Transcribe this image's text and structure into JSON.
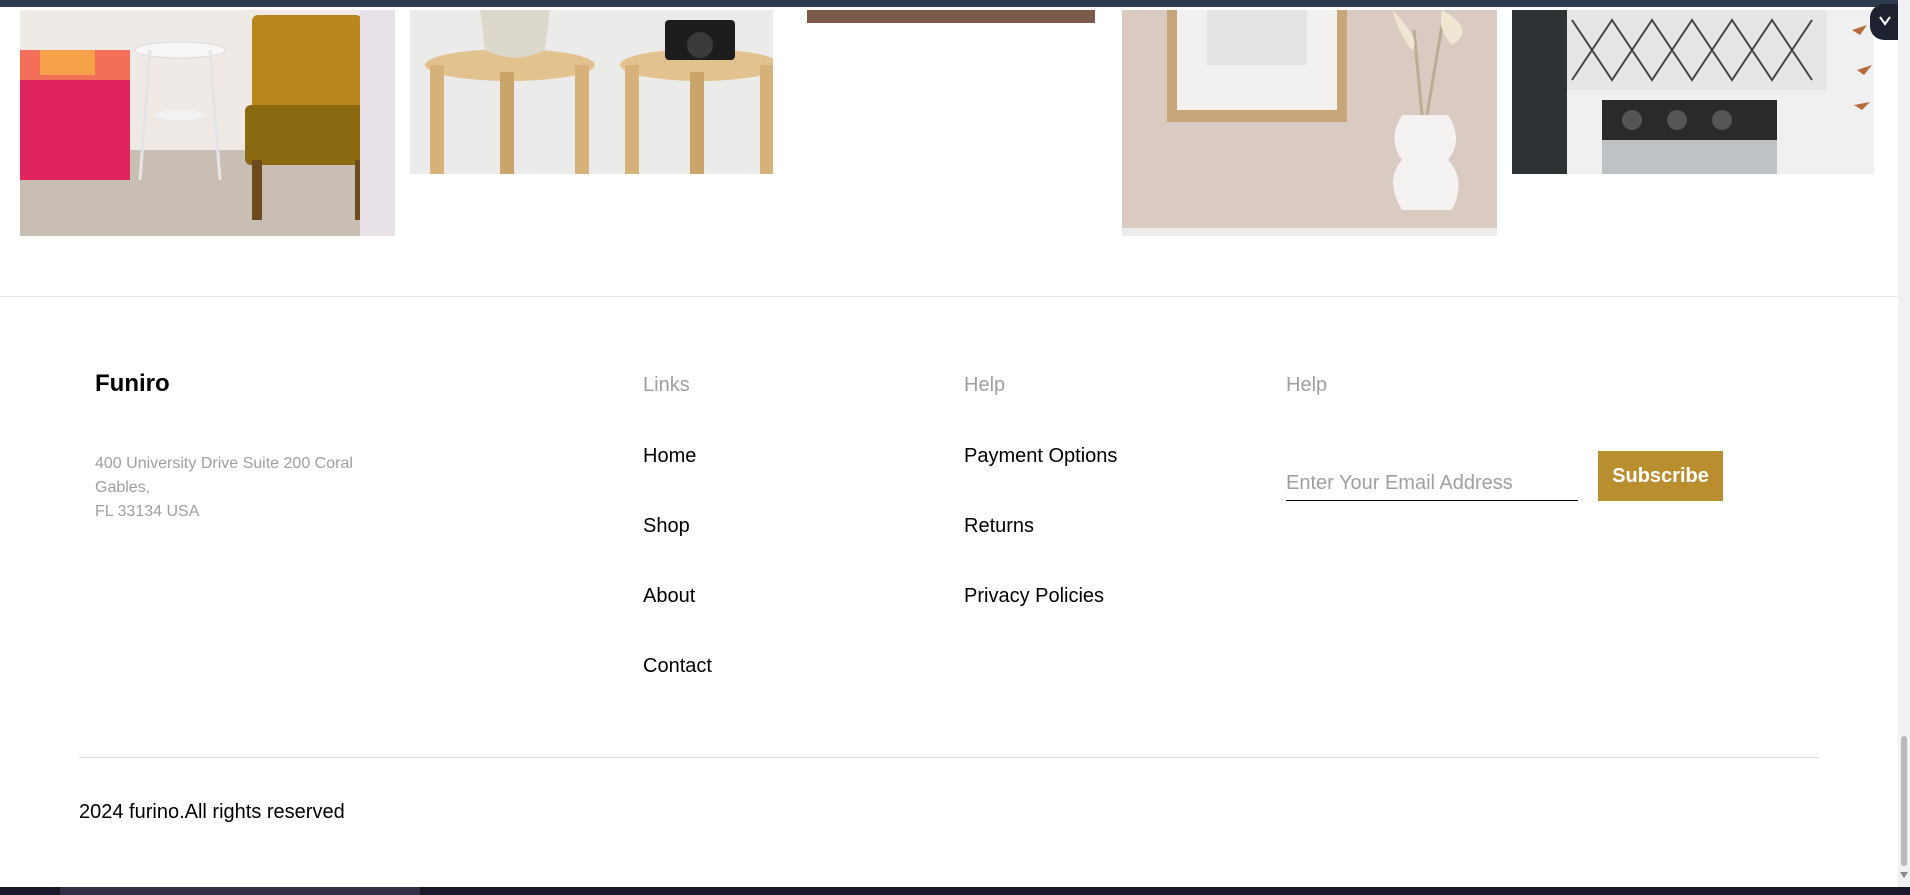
{
  "footer": {
    "brand": "Funiro",
    "address_lines": [
      "400 University Drive Suite 200 Coral",
      "Gables,",
      "FL 33134 USA"
    ],
    "columns": [
      {
        "title": "Links",
        "items": [
          "Home",
          "Shop",
          "About",
          "Contact"
        ]
      },
      {
        "title": "Help",
        "items": [
          "Payment Options",
          "Returns",
          "Privacy Policies"
        ]
      },
      {
        "title": "Help"
      }
    ],
    "newsletter": {
      "placeholder": "Enter Your Email Address",
      "button_label": "Subscribe"
    },
    "copyright": "2024 furino.All rights reserved"
  },
  "colors": {
    "accent": "#b88e2f",
    "muted_text": "#9f9f9f"
  },
  "icons": {
    "corner_badge": "chevron-down-icon"
  }
}
